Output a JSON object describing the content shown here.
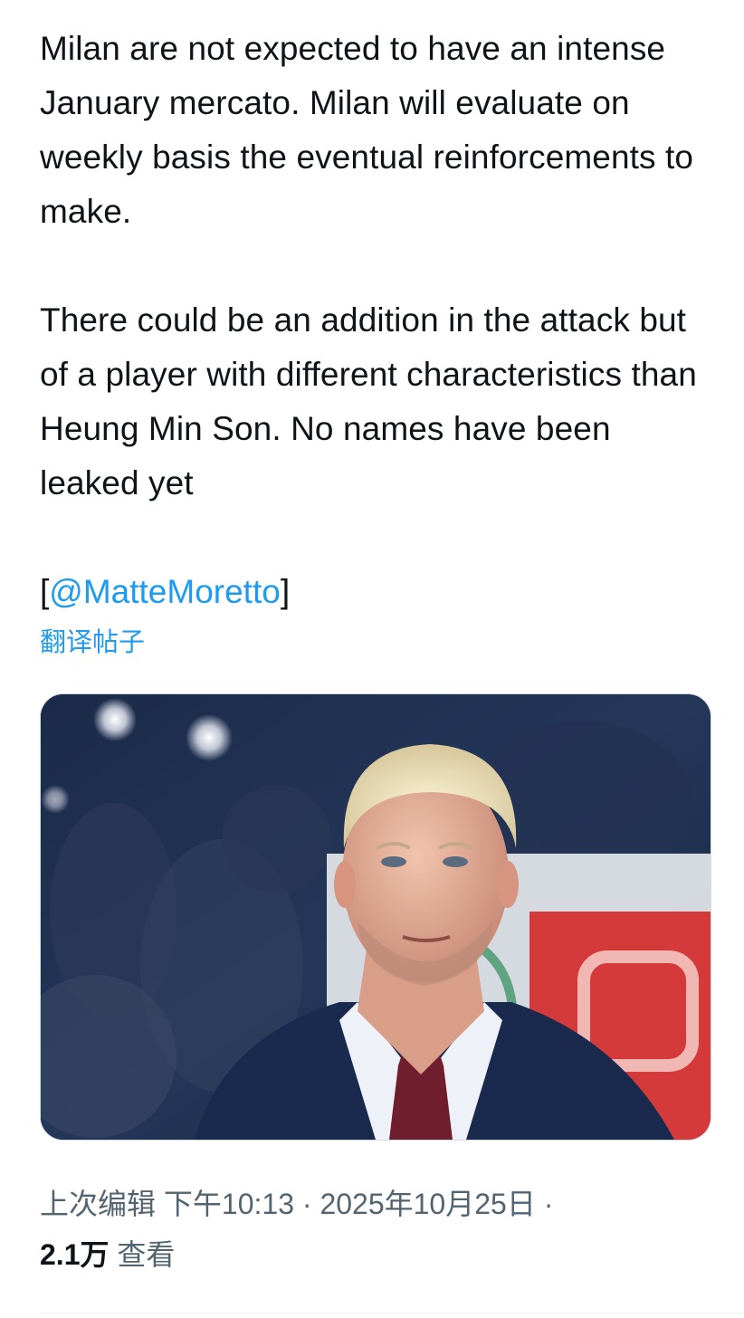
{
  "tweet": {
    "paragraph_1": "Milan are not expected to have an intense January mercato. Milan will evaluate on weekly basis the eventual reinforcements to make.",
    "paragraph_2": "There could be an addition in the attack but of a player with different characteristics than Heung Min Son. No names have been leaked yet",
    "source_open": "[",
    "mention": "@MatteMoretto",
    "source_close": "]",
    "translate_label": "翻译帖子"
  },
  "media": {
    "alt": "photo of a man in a suit and tie in a stadium",
    "colors": {
      "background": "#14233e",
      "suit": "#1a2a4e",
      "shirt": "#eef1f7",
      "tie": "#6e1e2c",
      "skin": "#e8b29c",
      "hair": "#f1e6c2"
    }
  },
  "meta": {
    "edited_label": "上次编辑",
    "time": "下午10:13",
    "separator": "·",
    "date": "2025年10月25日",
    "trailing_separator": "·"
  },
  "stats": {
    "views_count": "2.1万",
    "views_label": "查看"
  },
  "colors": {
    "link": "#1d9bf0",
    "text": "#0f1419",
    "secondary": "#536471"
  }
}
